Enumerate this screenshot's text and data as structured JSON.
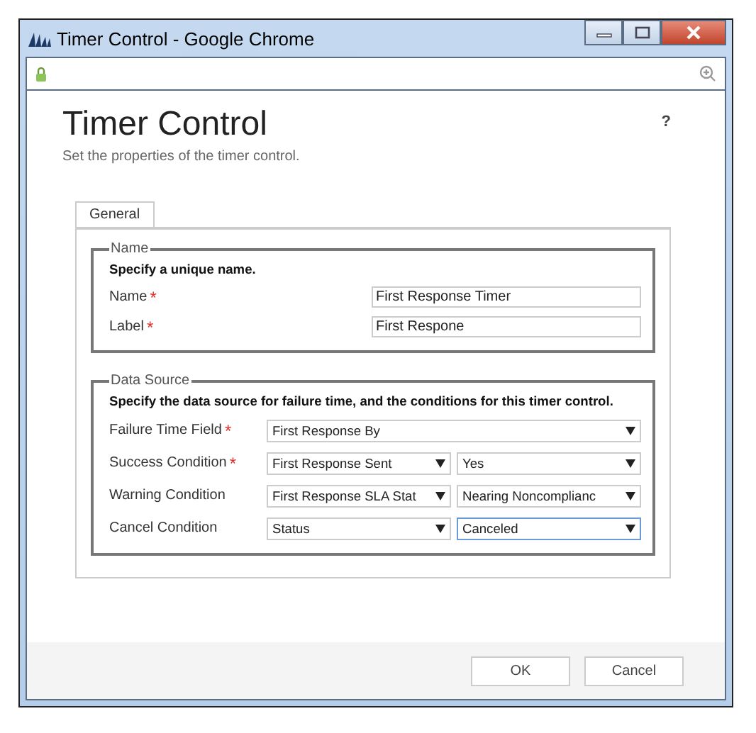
{
  "window": {
    "title": "Timer Control - Google Chrome"
  },
  "dialog": {
    "title": "Timer Control",
    "subtitle": "Set the properties of the timer control.",
    "help": "?"
  },
  "tabs": [
    {
      "label": "General",
      "selected": true
    }
  ],
  "name_section": {
    "legend": "Name",
    "instruction": "Specify a unique name.",
    "fields": [
      {
        "label": "Name",
        "marker": "*",
        "value": "First Response Timer"
      },
      {
        "label": "Label",
        "marker": "*",
        "value": "First Respone"
      }
    ]
  },
  "data_source_section": {
    "legend": "Data Source",
    "instruction": "Specify the data source for failure time, and the conditions for this timer control.",
    "fields": [
      {
        "label": "Failure Time Field",
        "marker": "*",
        "dropdowns": [
          {
            "value": "First Response By",
            "focused": false
          }
        ]
      },
      {
        "label": "Success Condition",
        "marker": "*",
        "dropdowns": [
          {
            "value": "First Response Sent",
            "focused": false
          },
          {
            "value": "Yes",
            "focused": false
          }
        ]
      },
      {
        "label": "Warning Condition",
        "dropdowns": [
          {
            "value": "First Response SLA Stat",
            "focused": false
          },
          {
            "value": "Nearing Noncomplianc",
            "focused": false
          }
        ]
      },
      {
        "label": "Cancel Condition",
        "dropdowns": [
          {
            "value": "Status",
            "focused": false
          },
          {
            "value": "Canceled",
            "focused": true
          }
        ]
      }
    ]
  },
  "buttons": [
    "OK",
    "Cancel"
  ]
}
